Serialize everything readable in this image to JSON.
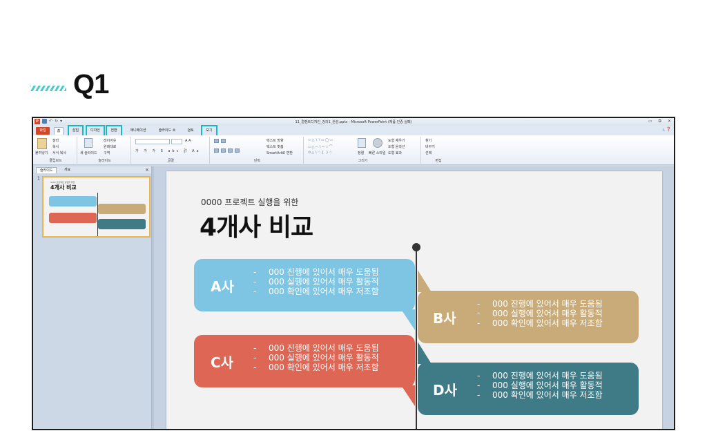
{
  "heading": {
    "title": "Q1"
  },
  "window": {
    "title": "11_컬렌트디자인_강의1_완성.pptx - Microsoft PowerPoint (제품 인증 실패)",
    "win_controls": [
      "▭",
      "⧉",
      "✕"
    ]
  },
  "ribbon": {
    "tabs": [
      "파일",
      "홈",
      "삽입",
      "디자인",
      "전환",
      "애니메이션",
      "슬라이드 쇼",
      "검토",
      "보기"
    ],
    "highlighted_tabs": [
      "삽입",
      "디자인",
      "전환",
      "보기"
    ],
    "groups": {
      "clipboard": {
        "label": "클립보드",
        "paste": "붙여넣기",
        "cut": "잘라",
        "copy": "복사",
        "format": "서식 복사"
      },
      "slides": {
        "label": "슬라이드",
        "new_slide": "새 슬라이드",
        "layout": "레이아웃",
        "reset": "원래대로",
        "section": "구역"
      },
      "font": {
        "label": "글꼴"
      },
      "paragraph": {
        "label": "단락",
        "text_dir": "텍스트 방향",
        "align_text": "텍스트 맞춤",
        "smartart": "SmartArt로 변환"
      },
      "drawing": {
        "label": "그리기",
        "arrange": "정렬",
        "quick_styles": "빠른 스타일",
        "fill": "도형 채우기",
        "outline": "도형 윤곽선",
        "effects": "도형 효과"
      },
      "editing": {
        "label": "편집",
        "find": "찾기",
        "replace": "바꾸기",
        "select": "선택"
      }
    }
  },
  "panel": {
    "tabs": [
      "슬라이드",
      "개요"
    ],
    "close": "×",
    "thumb_number": "1"
  },
  "slide": {
    "subtitle": "0000 프로젝트 실행을 위한",
    "title": "4개사 비교",
    "cards": [
      {
        "name": "A사",
        "color": "#7ec4e3",
        "items": [
          "000 진행에 있어서 매우 도움됨",
          "000 실행에 있어서 매우 활동적",
          "000 확인에 있어서 매우 저조함"
        ]
      },
      {
        "name": "B사",
        "color": "#c9ab79",
        "items": [
          "000 진행에 있어서 매우 도움됨",
          "000 실행에 있어서 매우 활동적",
          "000 확인에 있어서 매우 저조함"
        ]
      },
      {
        "name": "C사",
        "color": "#dd6655",
        "items": [
          "000 진행에 있어서 매우 도움됨",
          "000 실행에 있어서 매우 활동적",
          "000 확인에 있어서 매우 저조함"
        ]
      },
      {
        "name": "D사",
        "color": "#3f7a87",
        "items": [
          "000 진행에 있어서 매우 도움됨",
          "000 실행에 있어서 매우 활동적",
          "000 확인에 있어서 매우 저조함"
        ]
      }
    ]
  },
  "colors": {
    "highlight": "#17b8c9",
    "file_tab": "#d24726",
    "ribbon_bg": "#dfe8f3"
  }
}
